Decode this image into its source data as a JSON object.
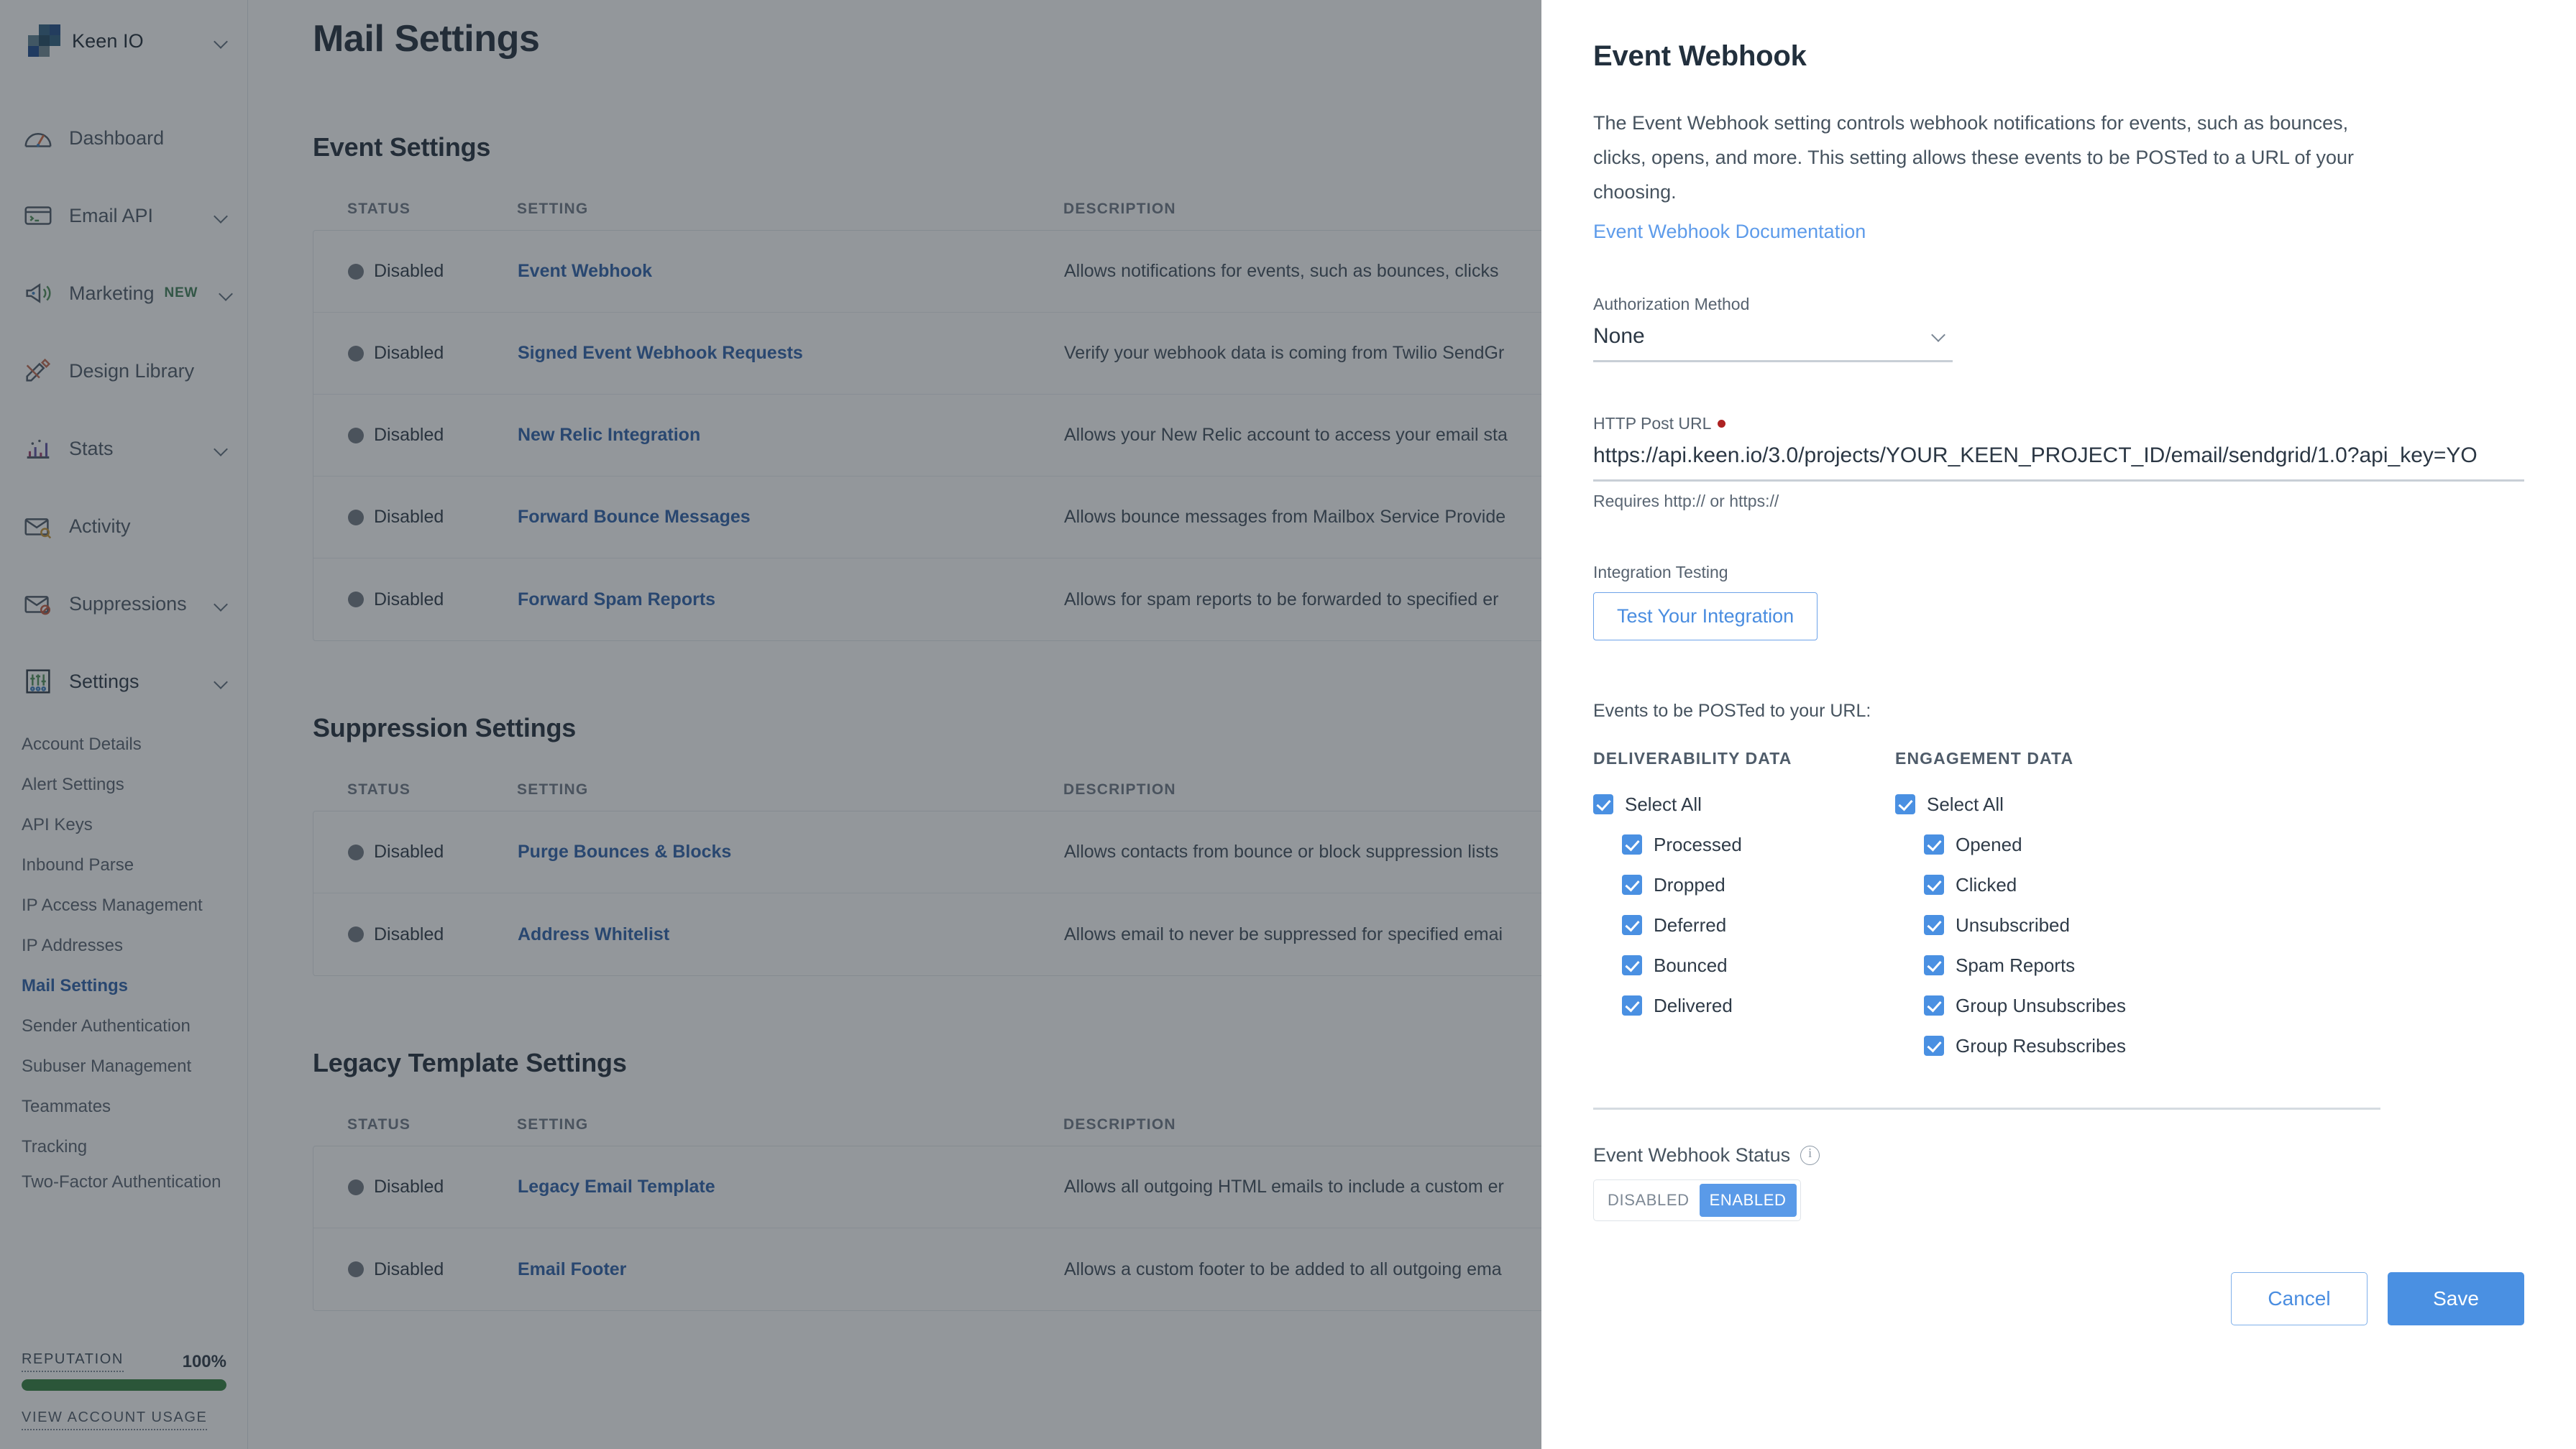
{
  "sidebar": {
    "brand": {
      "name": "Keen IO",
      "chevron": "chevron-down-icon"
    },
    "nav": [
      {
        "label": "Dashboard",
        "icon": "gauge-icon",
        "has_chevron": false,
        "badge": ""
      },
      {
        "label": "Email API",
        "icon": "terminal-icon",
        "has_chevron": true,
        "badge": ""
      },
      {
        "label": "Marketing",
        "icon": "megaphone-icon",
        "has_chevron": true,
        "badge": "NEW"
      },
      {
        "label": "Design Library",
        "icon": "pencil-ruler-icon",
        "has_chevron": false,
        "badge": ""
      },
      {
        "label": "Stats",
        "icon": "bar-chart-icon",
        "has_chevron": true,
        "badge": ""
      },
      {
        "label": "Activity",
        "icon": "envelope-search-icon",
        "has_chevron": false,
        "badge": ""
      },
      {
        "label": "Suppressions",
        "icon": "envelope-block-icon",
        "has_chevron": true,
        "badge": ""
      },
      {
        "label": "Settings",
        "icon": "sliders-icon",
        "has_chevron": true,
        "badge": ""
      }
    ],
    "subnav": [
      {
        "label": "Account Details",
        "active": false
      },
      {
        "label": "Alert Settings",
        "active": false
      },
      {
        "label": "API Keys",
        "active": false
      },
      {
        "label": "Inbound Parse",
        "active": false
      },
      {
        "label": "IP Access Management",
        "active": false
      },
      {
        "label": "IP Addresses",
        "active": false
      },
      {
        "label": "Mail Settings",
        "active": true
      },
      {
        "label": "Sender Authentication",
        "active": false
      },
      {
        "label": "Subuser Management",
        "active": false
      },
      {
        "label": "Teammates",
        "active": false
      },
      {
        "label": "Tracking",
        "active": false
      },
      {
        "label": "Two-Factor Authentication",
        "active": false
      }
    ],
    "reputation": {
      "label": "REPUTATION",
      "value": "100%",
      "percent": 100,
      "bar_color": "#2f7d3a"
    },
    "account_usage_link": "VIEW ACCOUNT USAGE"
  },
  "main": {
    "page_title": "Mail Settings",
    "columns": {
      "status": "STATUS",
      "setting": "SETTING",
      "description": "DESCRIPTION"
    },
    "sections": [
      {
        "title": "Event Settings",
        "rows": [
          {
            "status": "Disabled",
            "setting": "Event Webhook",
            "description": "Allows notifications for events, such as bounces, clicks"
          },
          {
            "status": "Disabled",
            "setting": "Signed Event Webhook Requests",
            "description": "Verify your webhook data is coming from Twilio SendGr"
          },
          {
            "status": "Disabled",
            "setting": "New Relic Integration",
            "description": "Allows your New Relic account to access your email sta"
          },
          {
            "status": "Disabled",
            "setting": "Forward Bounce Messages",
            "description": "Allows bounce messages from Mailbox Service Provide"
          },
          {
            "status": "Disabled",
            "setting": "Forward Spam Reports",
            "description": "Allows for spam reports to be forwarded to specified er"
          }
        ]
      },
      {
        "title": "Suppression Settings",
        "rows": [
          {
            "status": "Disabled",
            "setting": "Purge Bounces & Blocks",
            "description": "Allows contacts from bounce or block suppression lists"
          },
          {
            "status": "Disabled",
            "setting": "Address Whitelist",
            "description": "Allows email to never be suppressed for specified emai"
          }
        ]
      },
      {
        "title": "Legacy Template Settings",
        "rows": [
          {
            "status": "Disabled",
            "setting": "Legacy Email Template",
            "description": "Allows all outgoing HTML emails to include a custom er"
          },
          {
            "status": "Disabled",
            "setting": "Email Footer",
            "description": "Allows a custom footer to be added to all outgoing ema"
          }
        ]
      }
    ]
  },
  "panel": {
    "title": "Event Webhook",
    "description": "The Event Webhook setting controls webhook notifications for events, such as bounces, clicks, opens, and more. This setting allows these events to be POSTed to a URL of your choosing.",
    "doc_link": "Event Webhook Documentation",
    "auth_method": {
      "label": "Authorization Method",
      "value": "None",
      "chevron": "chevron-down-icon"
    },
    "post_url": {
      "label": "HTTP Post URL",
      "required": true,
      "value": "https://api.keen.io/3.0/projects/YOUR_KEEN_PROJECT_ID/email/sendgrid/1.0?api_key=YO",
      "helper": "Requires http:// or https://"
    },
    "integration_testing": {
      "label": "Integration Testing",
      "button": "Test Your Integration"
    },
    "events_label": "Events to be POSTed to your URL:",
    "event_groups": [
      {
        "heading": "DELIVERABILITY DATA",
        "select_all": {
          "label": "Select All",
          "checked": true
        },
        "items": [
          {
            "label": "Processed",
            "checked": true
          },
          {
            "label": "Dropped",
            "checked": true
          },
          {
            "label": "Deferred",
            "checked": true
          },
          {
            "label": "Bounced",
            "checked": true
          },
          {
            "label": "Delivered",
            "checked": true
          }
        ]
      },
      {
        "heading": "ENGAGEMENT DATA",
        "select_all": {
          "label": "Select All",
          "checked": true
        },
        "items": [
          {
            "label": "Opened",
            "checked": true
          },
          {
            "label": "Clicked",
            "checked": true
          },
          {
            "label": "Unsubscribed",
            "checked": true
          },
          {
            "label": "Spam Reports",
            "checked": true
          },
          {
            "label": "Group Unsubscribes",
            "checked": true
          },
          {
            "label": "Group Resubscribes",
            "checked": true
          }
        ]
      }
    ],
    "webhook_status": {
      "label": "Event Webhook Status",
      "info_icon": "info-icon",
      "options": [
        {
          "label": "DISABLED",
          "selected": false
        },
        {
          "label": "ENABLED",
          "selected": true
        }
      ]
    },
    "actions": {
      "cancel": "Cancel",
      "save": "Save"
    }
  },
  "colors": {
    "accent_blue": "#4a90e2",
    "link_blue": "#2a5fa8",
    "status_green": "#2f7d3a",
    "overlay": "rgba(40,48,56,0.50)"
  }
}
